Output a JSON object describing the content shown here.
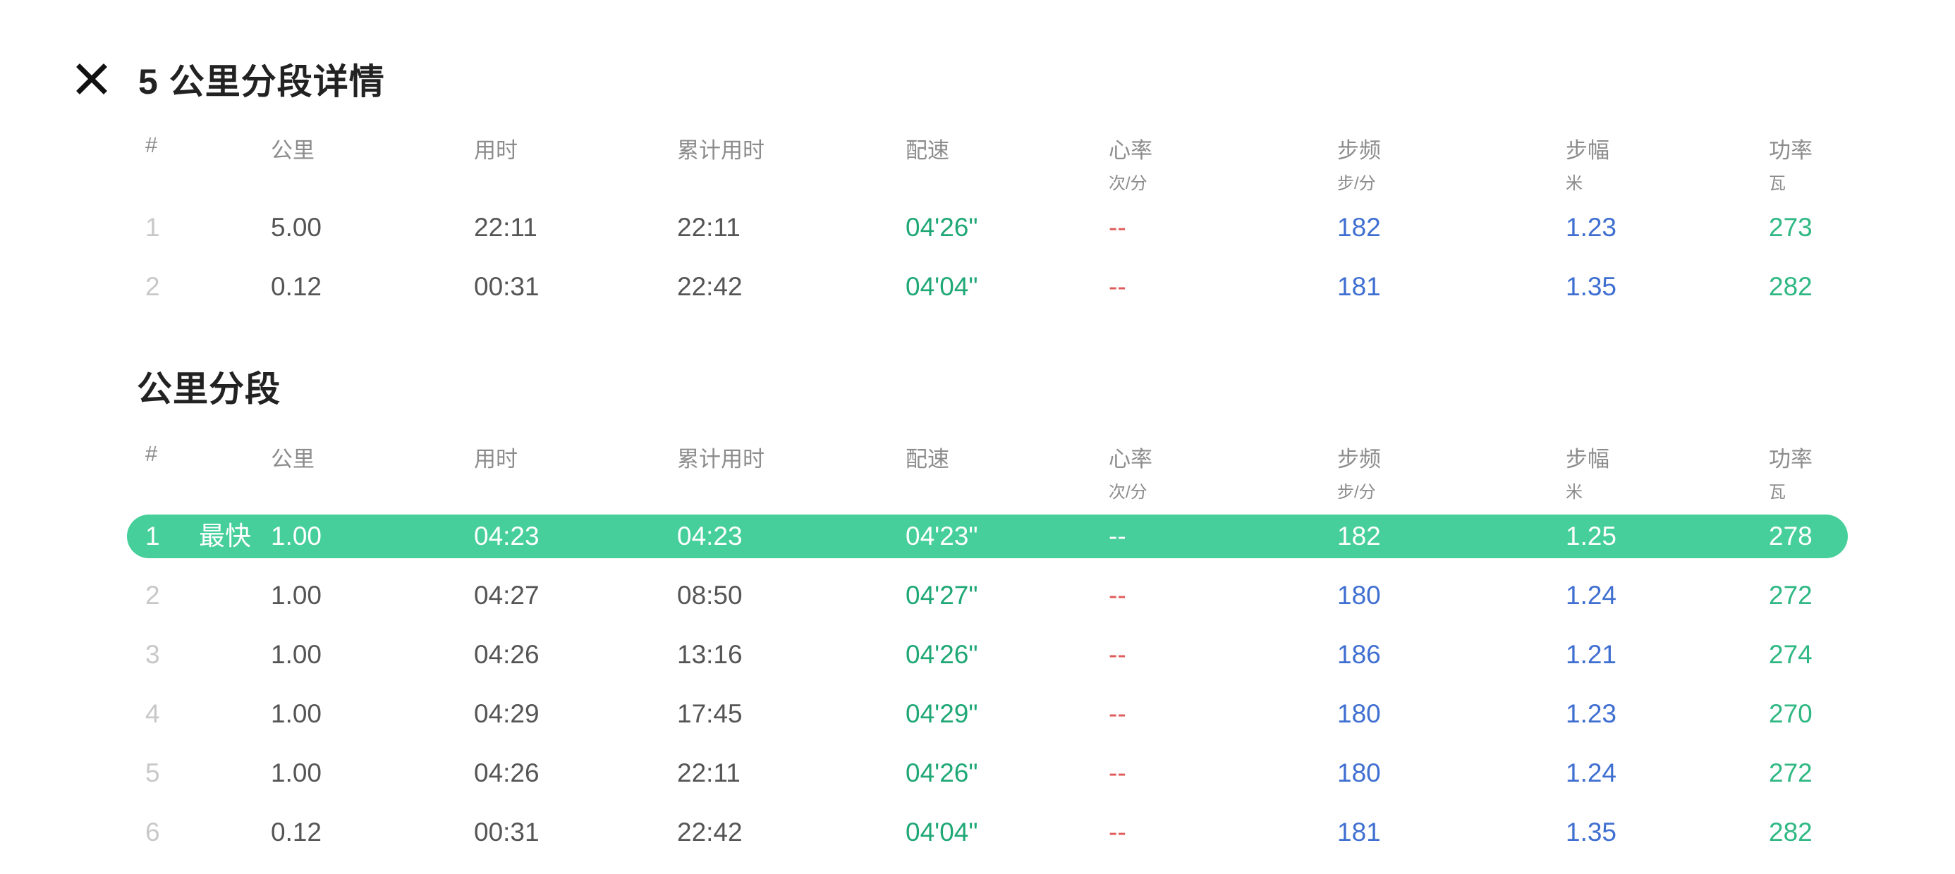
{
  "header": {
    "title": "5 公里分段详情",
    "close_icon": "close-icon"
  },
  "columns": [
    {
      "label": "#",
      "unit": ""
    },
    {
      "label": "公里",
      "unit": ""
    },
    {
      "label": "用时",
      "unit": ""
    },
    {
      "label": "累计用时",
      "unit": ""
    },
    {
      "label": "配速",
      "unit": ""
    },
    {
      "label": "心率",
      "unit": "次/分"
    },
    {
      "label": "步频",
      "unit": "步/分"
    },
    {
      "label": "步幅",
      "unit": "米"
    },
    {
      "label": "功率",
      "unit": "瓦"
    }
  ],
  "segments": [
    {
      "idx": "1",
      "km": "5.00",
      "time": "22:11",
      "cum": "22:11",
      "pace": "04'26\"",
      "hr": "--",
      "cadence": "182",
      "stride": "1.23",
      "power": "273"
    },
    {
      "idx": "2",
      "km": "0.12",
      "time": "00:31",
      "cum": "22:42",
      "pace": "04'04\"",
      "hr": "--",
      "cadence": "181",
      "stride": "1.35",
      "power": "282"
    }
  ],
  "km_section": {
    "title": "公里分段",
    "fastest_badge": "最快",
    "rows": [
      {
        "idx": "1",
        "km": "1.00",
        "time": "04:23",
        "cum": "04:23",
        "pace": "04'23\"",
        "hr": "--",
        "cadence": "182",
        "stride": "1.25",
        "power": "278",
        "fastest": true
      },
      {
        "idx": "2",
        "km": "1.00",
        "time": "04:27",
        "cum": "08:50",
        "pace": "04'27\"",
        "hr": "--",
        "cadence": "180",
        "stride": "1.24",
        "power": "272"
      },
      {
        "idx": "3",
        "km": "1.00",
        "time": "04:26",
        "cum": "13:16",
        "pace": "04'26\"",
        "hr": "--",
        "cadence": "186",
        "stride": "1.21",
        "power": "274"
      },
      {
        "idx": "4",
        "km": "1.00",
        "time": "04:29",
        "cum": "17:45",
        "pace": "04'29\"",
        "hr": "--",
        "cadence": "180",
        "stride": "1.23",
        "power": "270"
      },
      {
        "idx": "5",
        "km": "1.00",
        "time": "04:26",
        "cum": "22:11",
        "pace": "04'26\"",
        "hr": "--",
        "cadence": "180",
        "stride": "1.24",
        "power": "272"
      },
      {
        "idx": "6",
        "km": "0.12",
        "time": "00:31",
        "cum": "22:42",
        "pace": "04'04\"",
        "hr": "--",
        "cadence": "181",
        "stride": "1.35",
        "power": "282"
      }
    ]
  },
  "colors": {
    "highlight": "#46cf9a",
    "pace": "#1fa876",
    "heart_rate": "#e05a5a",
    "cadence_stride": "#3f6fd1",
    "power": "#2fb883"
  }
}
